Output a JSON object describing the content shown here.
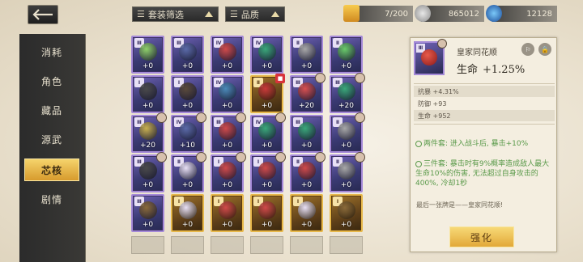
{
  "filters": {
    "set_filter": "套装筛选",
    "quality": "品质"
  },
  "resources": [
    {
      "name": "stamina",
      "value": "7/200",
      "color": "#f0b23a"
    },
    {
      "name": "coin",
      "value": "865012",
      "color": "#c8c8c8"
    },
    {
      "name": "gem",
      "value": "12128",
      "color": "#3a8ad8"
    }
  ],
  "sidebar": {
    "items": [
      {
        "label": "消耗"
      },
      {
        "label": "角色"
      },
      {
        "label": "藏品"
      },
      {
        "label": "源武"
      },
      {
        "label": "芯核",
        "active": true
      },
      {
        "label": "剧情"
      }
    ]
  },
  "cards": [
    {
      "rank": "Ⅲ",
      "level": "+0",
      "art": "#8fd06a",
      "avatar": false,
      "lock": false,
      "gold": false
    },
    {
      "rank": "Ⅲ",
      "level": "+0",
      "art": "#5a6aa8",
      "avatar": false,
      "lock": false,
      "gold": false
    },
    {
      "rank": "Ⅳ",
      "level": "+0",
      "art": "#d04a4a",
      "avatar": false,
      "lock": false,
      "gold": false
    },
    {
      "rank": "Ⅳ",
      "level": "+0",
      "art": "#3aa87a",
      "avatar": false,
      "lock": false,
      "gold": false
    },
    {
      "rank": "Ⅱ",
      "level": "+0",
      "art": "#a8a8a8",
      "avatar": false,
      "lock": false,
      "gold": false
    },
    {
      "rank": "Ⅱ",
      "level": "+0",
      "art": "#6acb6a",
      "avatar": false,
      "lock": false,
      "gold": false
    },
    {
      "rank": "Ⅰ",
      "level": "+0",
      "art": "#4a4a4a",
      "avatar": false,
      "lock": false,
      "gold": false
    },
    {
      "rank": "Ⅰ",
      "level": "+0",
      "art": "#5a4a3a",
      "avatar": false,
      "lock": false,
      "gold": false
    },
    {
      "rank": "Ⅳ",
      "level": "+0",
      "art": "#4a8ab8",
      "avatar": false,
      "lock": false,
      "gold": false
    },
    {
      "rank": "Ⅱ",
      "level": "+0",
      "art": "#c83a3a",
      "avatar": false,
      "lock": true,
      "gold": true
    },
    {
      "rank": "Ⅲ",
      "level": "+20",
      "art": "#d85050",
      "avatar": true,
      "lock": false,
      "gold": false
    },
    {
      "rank": "Ⅲ",
      "level": "+20",
      "art": "#3aa87a",
      "avatar": true,
      "lock": false,
      "gold": false
    },
    {
      "rank": "Ⅲ",
      "level": "+20",
      "art": "#c8b050",
      "avatar": true,
      "lock": false,
      "gold": false
    },
    {
      "rank": "Ⅳ",
      "level": "+10",
      "art": "#5a6aa8",
      "avatar": true,
      "lock": false,
      "gold": false
    },
    {
      "rank": "Ⅲ",
      "level": "+0",
      "art": "#d04a4a",
      "avatar": true,
      "lock": false,
      "gold": false
    },
    {
      "rank": "Ⅳ",
      "level": "+0",
      "art": "#3aa87a",
      "avatar": true,
      "lock": false,
      "gold": false
    },
    {
      "rank": "Ⅲ",
      "level": "+0",
      "art": "#3aa87a",
      "avatar": false,
      "lock": false,
      "gold": false
    },
    {
      "rank": "Ⅱ",
      "level": "+0",
      "art": "#a8a8a8",
      "avatar": true,
      "lock": false,
      "gold": false
    },
    {
      "rank": "Ⅲ",
      "level": "+0",
      "art": "#4a4a4a",
      "avatar": true,
      "lock": false,
      "gold": false
    },
    {
      "rank": "Ⅱ",
      "level": "+0",
      "art": "#e8e0f5",
      "avatar": true,
      "lock": false,
      "gold": false
    },
    {
      "rank": "Ⅰ",
      "level": "+0",
      "art": "#d04a4a",
      "avatar": true,
      "lock": false,
      "gold": false
    },
    {
      "rank": "Ⅰ",
      "level": "+0",
      "art": "#d04a4a",
      "avatar": true,
      "lock": false,
      "gold": false
    },
    {
      "rank": "Ⅱ",
      "level": "+0",
      "art": "#d04a4a",
      "avatar": true,
      "lock": false,
      "gold": false
    },
    {
      "rank": "Ⅱ",
      "level": "+0",
      "art": "#a8a8a8",
      "avatar": true,
      "lock": false,
      "gold": false
    },
    {
      "rank": "Ⅲ",
      "level": "+0",
      "art": "#8a6a3a",
      "avatar": false,
      "lock": false,
      "gold": false
    },
    {
      "rank": "Ⅰ",
      "level": "+0",
      "art": "#e8e0f5",
      "avatar": false,
      "lock": false,
      "gold": true
    },
    {
      "rank": "Ⅰ",
      "level": "+0",
      "art": "#d04a4a",
      "avatar": false,
      "lock": false,
      "gold": true
    },
    {
      "rank": "Ⅰ",
      "level": "+0",
      "art": "#d04a4a",
      "avatar": false,
      "lock": false,
      "gold": true
    },
    {
      "rank": "Ⅰ",
      "level": "+0",
      "art": "#e8e0f5",
      "avatar": false,
      "lock": false,
      "gold": true
    },
    {
      "rank": "Ⅰ",
      "level": "+0",
      "art": "#8a6a3a",
      "avatar": false,
      "lock": false,
      "gold": true
    }
  ],
  "detail": {
    "rank": "Ⅲ",
    "name": "皇家同花顺",
    "main_stat": "生命",
    "main_value": "+1.25%",
    "substats": [
      "抗暴 +4.31%",
      "防御 +93",
      "生命 +952"
    ],
    "set2": "两件套: 进入战斗后, 暴击+10%",
    "set3": "三件套: 暴击时有9%概率造成敌人最大生命10%的伤害, 无法超过自身攻击的400%, 冷却1秒",
    "flavor": "最后一张牌是——皇家同花顺!",
    "upgrade_label": "强化"
  }
}
